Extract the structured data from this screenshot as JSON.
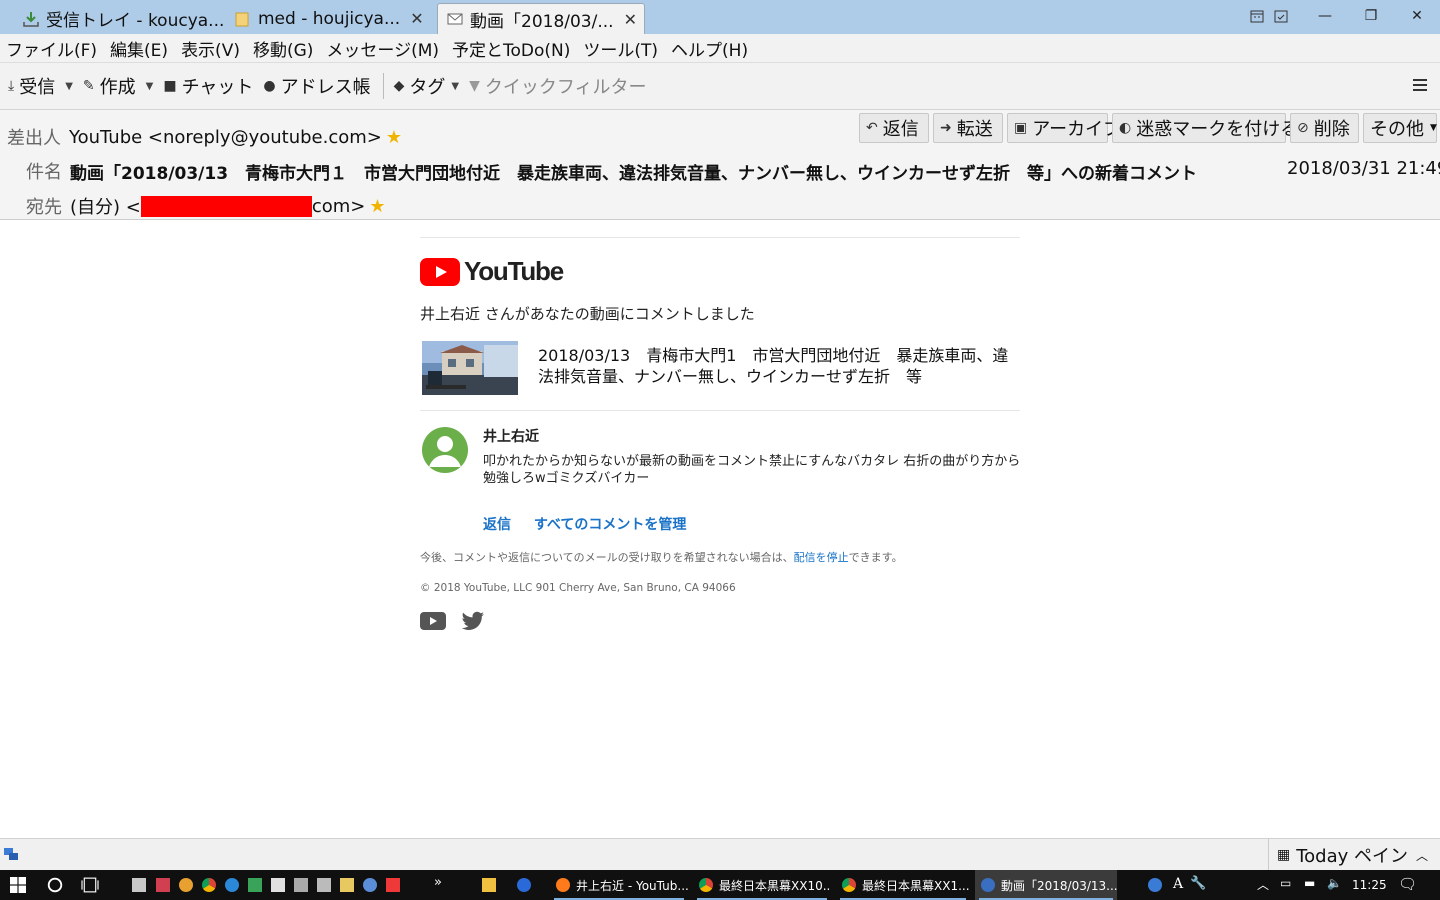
{
  "tabs": [
    {
      "label": "受信トレイ - koucya..."
    },
    {
      "label": "med - houjicya..."
    },
    {
      "label": "動画「2018/03/..."
    }
  ],
  "menu": [
    "ファイル(F)",
    "編集(E)",
    "表示(V)",
    "移動(G)",
    "メッセージ(M)",
    "予定とToDo(N)",
    "ツール(T)",
    "ヘルプ(H)"
  ],
  "toolbar": {
    "get_mail": "受信",
    "write": "作成",
    "chat": "チャット",
    "address_book": "アドレス帳",
    "tag": "タグ",
    "quick_filter": "クイックフィルター"
  },
  "header": {
    "from_label": "差出人",
    "from_value": "YouTube <noreply@youtube.com>",
    "subject_label": "件名",
    "subject": "動画「2018/03/13　青梅市大門１　市営大門団地付近　暴走族車両、違法排気音量、ナンバー無し、ウインカーせず左折　等」への新着コメント",
    "date": "2018/03/31 21:49",
    "to_label": "宛先",
    "to_prefix": "(自分) <",
    "to_suffix": "com>",
    "buttons": {
      "reply": "返信",
      "forward": "転送",
      "archive": "アーカイブ",
      "junk": "迷惑マークを付ける",
      "delete": "削除",
      "other": "その他"
    }
  },
  "email": {
    "brand": "YouTube",
    "intro": "井上右近 さんがあなたの動画にコメントしました",
    "video_title": "2018/03/13　青梅市大門1　市営大門団地付近　暴走族車両、違法排気音量、ナンバー無し、ウインカーせず左折　等",
    "commenter": "井上右近",
    "comment": "叩かれたからか知らないが最新の動画をコメント禁止にすんなバカタレ 右折の曲がり方から勉強しろwゴミクズバイカー",
    "reply_link": "返信",
    "manage_link": "すべてのコメントを管理",
    "unsub_before": "今後、コメントや返信についてのメールの受け取りを希望されない場合は、",
    "unsub_link": "配信を停止",
    "unsub_after": "できます。",
    "copyright": "© 2018 YouTube, LLC 901 Cherry Ave, San Bruno, CA 94066"
  },
  "statusbar": {
    "today_pane": "Today ペイン"
  },
  "taskbar": {
    "tasks": [
      "井上右近 - YouTub...",
      "最終日本黒幕XX10...",
      "最終日本黒幕XX1...",
      "動画「2018/03/13..."
    ],
    "overflow": "»",
    "ime": "A",
    "time": "11:25"
  },
  "colors": {
    "titlebar": "#aecce8",
    "link": "#1a73c8",
    "youtube_red": "#ff0000",
    "avatar": "#6aaf49"
  }
}
